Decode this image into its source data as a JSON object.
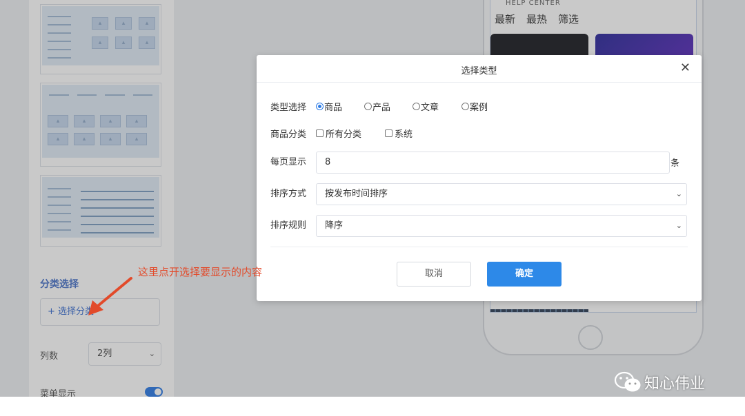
{
  "left_panel": {
    "section_title": "分类选择",
    "select_category_label": "+ 选择分类",
    "columns_label": "列数",
    "columns_value": "2列",
    "menu_display_label": "菜单显示",
    "menu_display_on": true
  },
  "phone_preview": {
    "header_text": "HELP CENTER",
    "filter_tabs": [
      "最新",
      "最热",
      "筛选"
    ]
  },
  "dialog": {
    "title": "选择类型",
    "close_symbol": "✕",
    "type_label": "类型选择",
    "type_options": [
      "商品",
      "产品",
      "文章",
      "案例"
    ],
    "type_selected": "商品",
    "category_label": "商品分类",
    "category_options": [
      "所有分类",
      "系统"
    ],
    "per_page_label": "每页显示",
    "per_page_value": "8",
    "per_page_unit": "条",
    "sort_label": "排序方式",
    "sort_value": "按发布时间排序",
    "order_label": "排序规则",
    "order_value": "降序",
    "cancel_label": "取消",
    "confirm_label": "确定"
  },
  "annotation": {
    "text": "这里点开选择要显示的内容",
    "color": "#e24a2a"
  },
  "watermark": {
    "text": "知心伟业"
  },
  "colors": {
    "accent": "#2d89e8",
    "section_title": "#4a74c9",
    "annotation": "#e24a2a"
  }
}
